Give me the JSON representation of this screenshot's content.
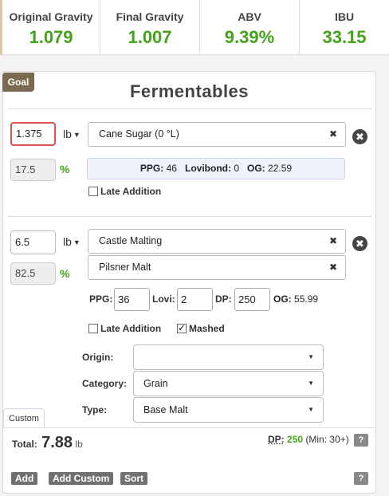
{
  "stats": [
    {
      "label": "Original Gravity",
      "value": "1.079"
    },
    {
      "label": "Final Gravity",
      "value": "1.007"
    },
    {
      "label": "ABV",
      "value": "9.39%"
    },
    {
      "label": "IBU",
      "value": "33.15"
    }
  ],
  "panel": {
    "goal_tab": "Goal",
    "title": "Fermentables"
  },
  "fermentables": [
    {
      "amount": "1.375",
      "unit": "lb",
      "percent": "17.5",
      "percent_symbol": "%",
      "name": "Cane Sugar (0 °L)",
      "remove_glyph": "✖",
      "info": {
        "ppg_label": "PPG:",
        "ppg": "46",
        "lovibond_label": "Lovibond:",
        "lovibond": "0",
        "og_label": "OG:",
        "og": "22.59"
      },
      "late_addition_label": "Late Addition",
      "late_addition": false
    },
    {
      "amount": "6.5",
      "unit": "lb",
      "percent": "82.5",
      "percent_symbol": "%",
      "maltster": "Castle Malting",
      "name": "Pilsner Malt",
      "remove_glyph": "✖",
      "ppg_label": "PPG:",
      "ppg": "36",
      "lovi_label": "Lovi:",
      "lovi": "2",
      "dp_label": "DP:",
      "dp": "250",
      "og_label": "OG:",
      "og": "55.99",
      "late_addition_label": "Late Addition",
      "late_addition": false,
      "mashed_label": "Mashed",
      "mashed": true,
      "origin_label": "Origin:",
      "origin": "",
      "category_label": "Category:",
      "category": "Grain",
      "type_label": "Type:",
      "type": "Base Malt"
    }
  ],
  "custom_tab": "Custom",
  "footer": {
    "total_label": "Total:",
    "total_value": "7.88",
    "total_unit": "lb",
    "dp_label": "DP:",
    "dp_value": "250",
    "dp_min": "(Min: 30+)",
    "help": "?"
  },
  "buttons": {
    "add": "Add",
    "add_custom": "Add Custom",
    "sort": "Sort"
  },
  "colors": {
    "accent_green": "#44a21a",
    "goal_tab": "#7a6a52",
    "error_border": "#d9534f"
  }
}
